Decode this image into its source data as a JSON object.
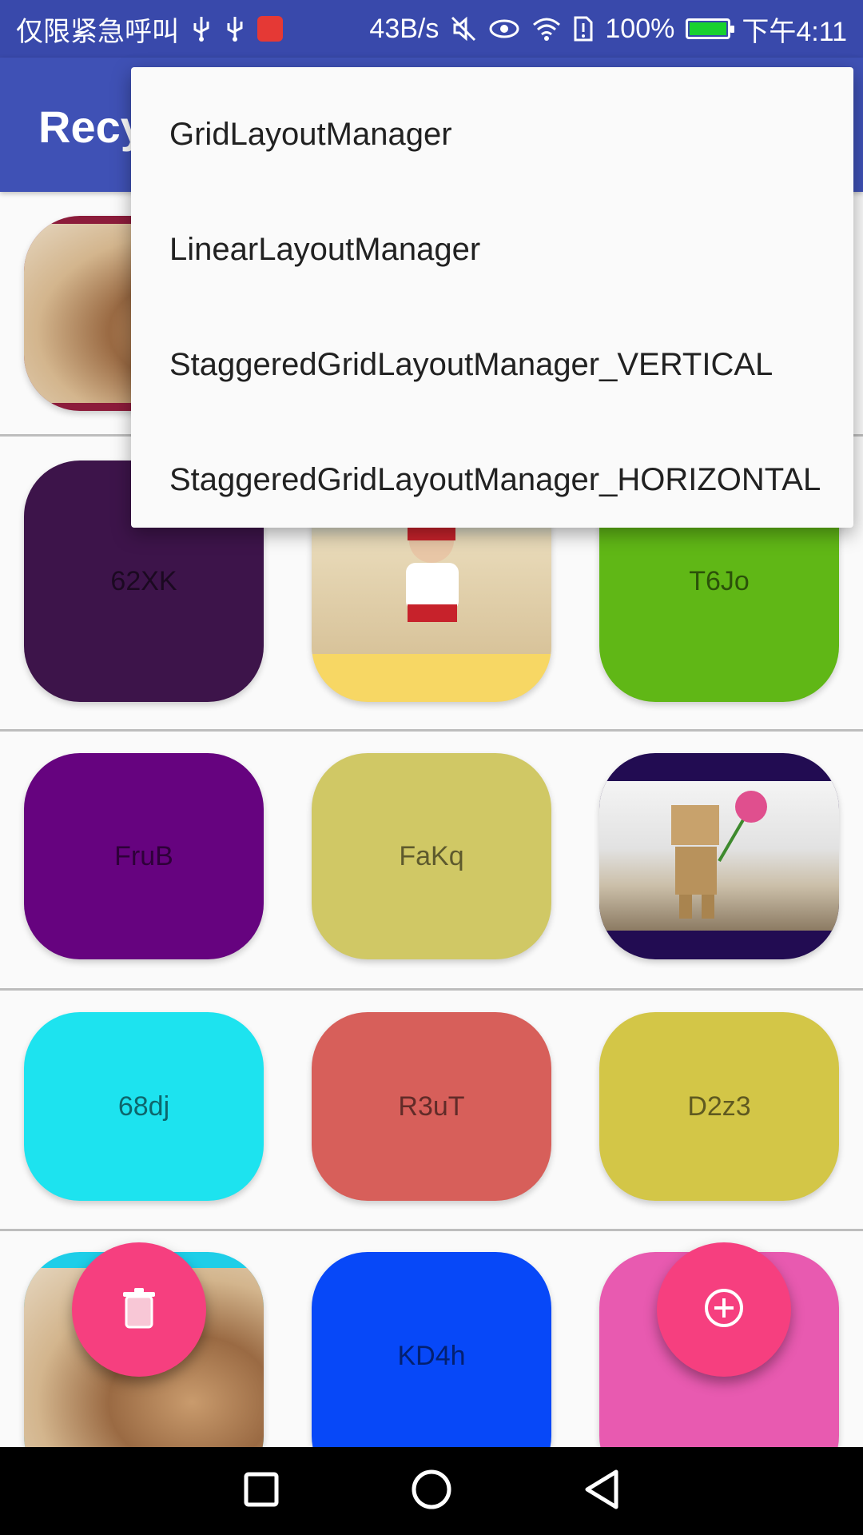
{
  "status_bar": {
    "emergency_text": "仅限紧急呼叫",
    "network_speed": "43B/s",
    "battery_percent": "100%",
    "time": "下午4:11"
  },
  "app_bar": {
    "title": "Recy"
  },
  "popup_menu": {
    "items": [
      "GridLayoutManager",
      "LinearLayoutManager",
      "StaggeredGridLayoutManager_VERTICAL",
      "StaggeredGridLayoutManager_HORIZONTAL"
    ]
  },
  "grid": {
    "rows": [
      {
        "cells": [
          {
            "label": "",
            "color": "#8c1c3b",
            "image": "cat-photo"
          }
        ]
      },
      {
        "cells": [
          {
            "label": "62XK",
            "color": "#3d144a"
          },
          {
            "label": "",
            "color": "#f7d764",
            "image": "beach-photo"
          },
          {
            "label": "T6Jo",
            "color": "#60b716"
          }
        ]
      },
      {
        "cells": [
          {
            "label": "FruB",
            "color": "#66037f"
          },
          {
            "label": "FaKq",
            "color": "#d0c865"
          },
          {
            "label": "",
            "color": "#220c52",
            "image": "danbo-photo"
          }
        ]
      },
      {
        "cells": [
          {
            "label": "68dj",
            "color": "#1de3ef"
          },
          {
            "label": "R3uT",
            "color": "#d75f5a"
          },
          {
            "label": "D2z3",
            "color": "#d3c647"
          }
        ]
      },
      {
        "cells": [
          {
            "label": "",
            "color": "#1ecee8",
            "image": "cat-photo"
          },
          {
            "label": "KD4h",
            "color": "#0748f8"
          },
          {
            "label": "",
            "color": "#e85ab0"
          }
        ]
      }
    ]
  },
  "fab_delete": {
    "icon": "trash-icon",
    "color": "#f63f7f"
  },
  "fab_add": {
    "icon": "plus-circle-icon",
    "color": "#f63f7f"
  },
  "nav_bar": {
    "recents_icon": "square-icon",
    "home_icon": "circle-icon",
    "back_icon": "triangle-back-icon"
  }
}
